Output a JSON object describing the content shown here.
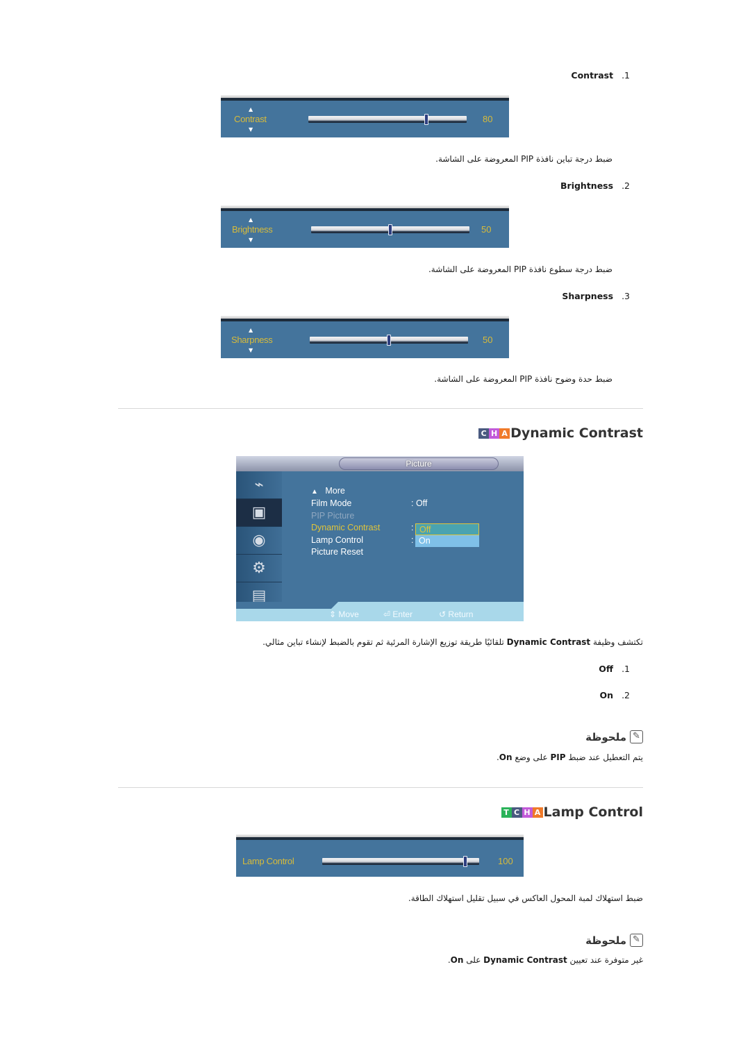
{
  "picture_settings": [
    {
      "index": ".1",
      "heading": "Contrast",
      "osd_label": "Contrast",
      "value": "80",
      "level_percent": 80,
      "description": "ضبط درجة تباين نافذة PIP المعروضة على الشاشة."
    },
    {
      "index": ".2",
      "heading": "Brightness",
      "osd_label": "Brightness",
      "value": "50",
      "level_percent": 50,
      "description": "ضبط درجة سطوع نافذة PIP المعروضة على الشاشة."
    },
    {
      "index": ".3",
      "heading": "Sharpness",
      "osd_label": "Sharpness",
      "value": "50",
      "level_percent": 50,
      "description": "ضبط حدة وضوح نافذة PIP المعروضة على الشاشة."
    }
  ],
  "dynamic_contrast": {
    "title": "Dynamic Contrast",
    "badges": [
      {
        "letter": "C",
        "color": "#4a5a80"
      },
      {
        "letter": "H",
        "color": "#c25ad9"
      },
      {
        "letter": "A",
        "color": "#f07a2a"
      }
    ],
    "menu": {
      "title": "Picture",
      "side_icons": [
        "input-icon",
        "picture-icon",
        "sound-icon",
        "setup-icon",
        "multi-control-icon"
      ],
      "active_side_index": 1,
      "items": [
        {
          "label": "More",
          "value": ""
        },
        {
          "label": "Film Mode",
          "value": ": Off"
        },
        {
          "label": "PIP Picture",
          "value": "",
          "disabled": true
        },
        {
          "label": "Dynamic Contrast",
          "value": ":",
          "selected": true
        },
        {
          "label": "Lamp Control",
          "value": ":"
        },
        {
          "label": "Picture Reset",
          "value": ""
        }
      ],
      "dropdown_options": [
        "Off",
        "On"
      ],
      "dropdown_highlighted": "Off",
      "hints": {
        "move": "Move",
        "enter": "Enter",
        "return": "Return"
      }
    },
    "description_prefix": "تكتشف وظيفة ",
    "description_bold": "Dynamic Contrast",
    "description_suffix": " تلقائيًا طريقة توزيع الإشارة المرئية ثم تقوم بالضبط لإنشاء تباين مثالي.",
    "options": [
      {
        "index": ".1",
        "label": "Off"
      },
      {
        "index": ".2",
        "label": "On"
      }
    ],
    "note": {
      "title": "ملحوظة",
      "text_prefix": "يتم التعطيل عند ضبط ",
      "text_bold1": "PIP",
      "text_mid": " على وضع ",
      "text_bold2": "On",
      "text_end": "."
    }
  },
  "lamp_control": {
    "title": "Lamp Control",
    "badges": [
      {
        "letter": "T",
        "color": "#2bb35a"
      },
      {
        "letter": "C",
        "color": "#4a5a80"
      },
      {
        "letter": "H",
        "color": "#c25ad9"
      },
      {
        "letter": "A",
        "color": "#f07a2a"
      }
    ],
    "osd_label": "Lamp Control",
    "value": "100",
    "level_percent": 100,
    "description": "ضبط استهلاك لمبة المحول العاكس في سبيل تقليل استهلاك الطاقة.",
    "note": {
      "title": "ملحوظة",
      "text_prefix": "غير متوفرة عند تعيين ",
      "text_bold1": "Dynamic Contrast",
      "text_mid": " على ",
      "text_bold2": "On",
      "text_end": "."
    }
  }
}
